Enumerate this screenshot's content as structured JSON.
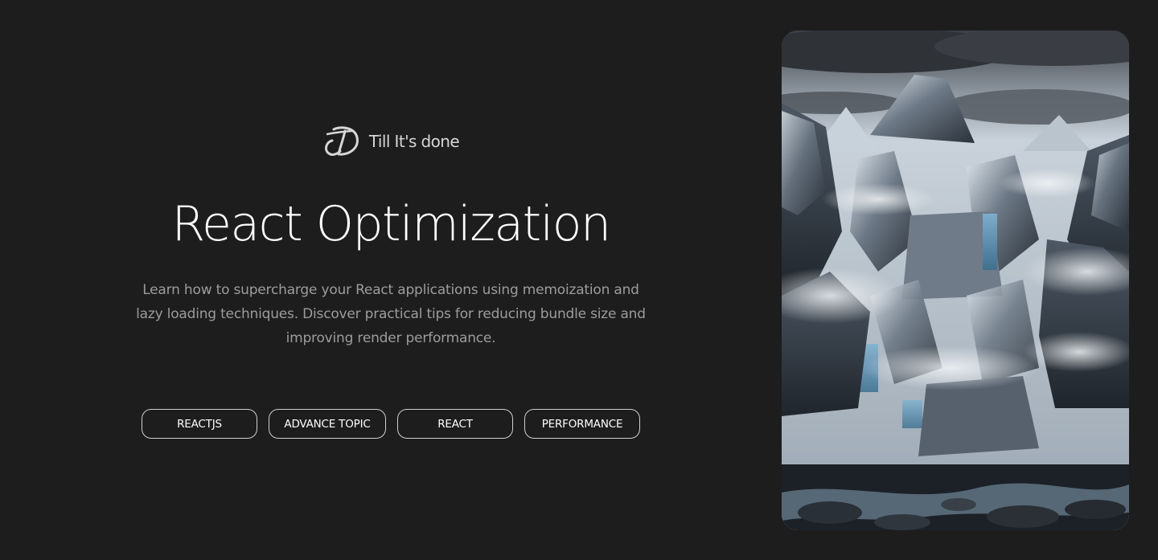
{
  "brand": {
    "name": "Till It's done",
    "logo_icon": "td-monogram-logo"
  },
  "hero": {
    "title": "React Optimization",
    "description": "Learn how to supercharge your React applications using memoization and lazy loading techniques. Discover practical tips for reducing bundle size and improving render performance."
  },
  "tags": [
    {
      "label": "REACTJS"
    },
    {
      "label": "ADVANCE TOPIC"
    },
    {
      "label": "REACT"
    },
    {
      "label": "PERFORMANCE"
    }
  ],
  "image": {
    "subject": "snowy-mountain-canyon-illustration"
  },
  "colors": {
    "background": "#1d1d1d",
    "text_primary": "#ffffff",
    "text_secondary": "#9c9c9c",
    "tag_border": "#cfcfcf"
  }
}
